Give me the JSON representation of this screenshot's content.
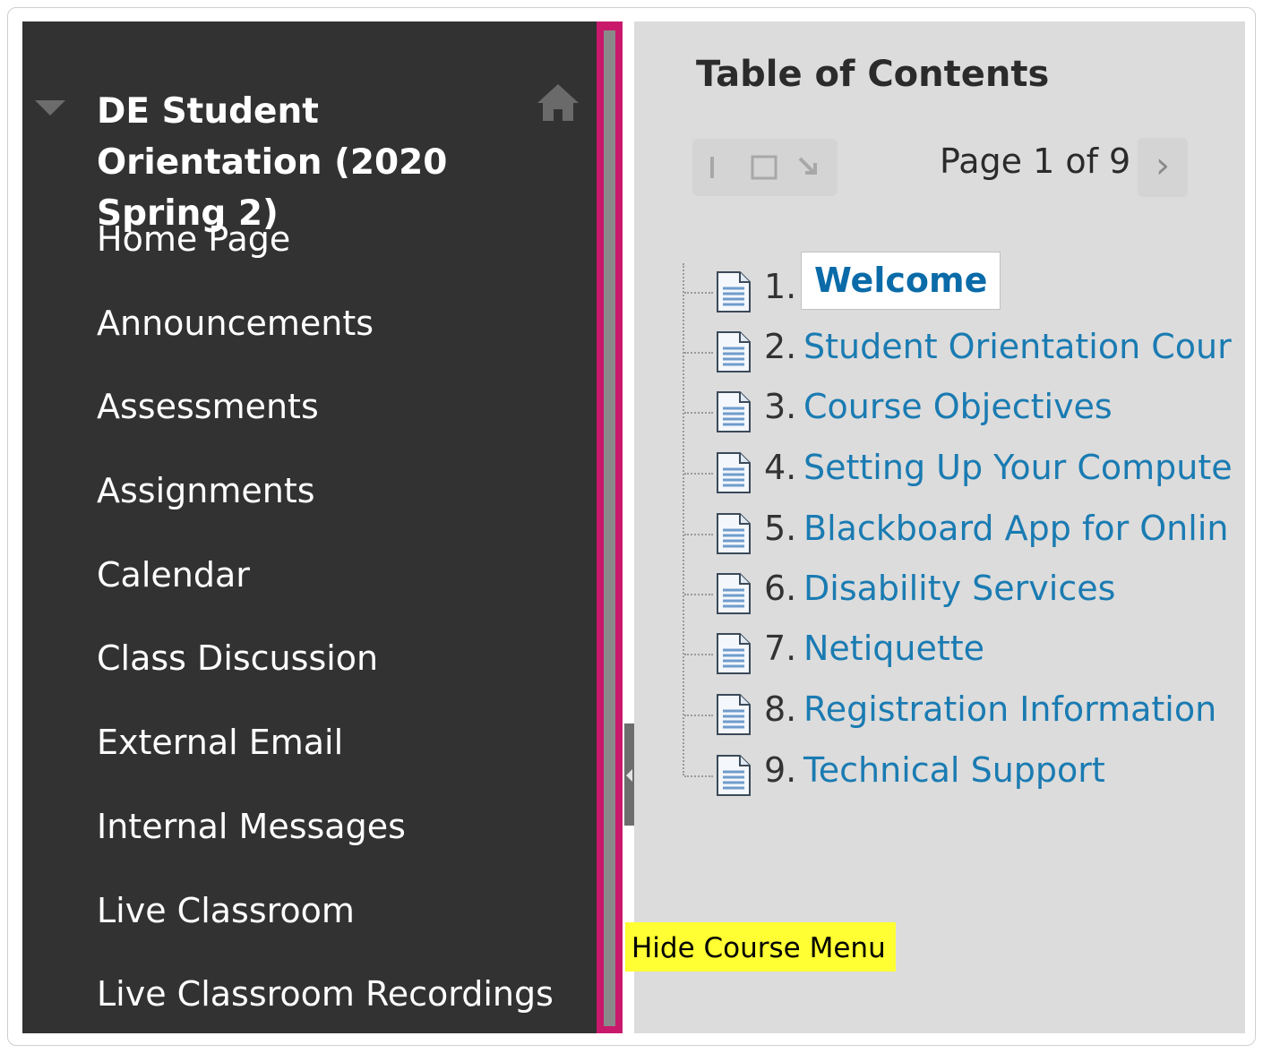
{
  "course_menu": {
    "course_title": "DE Student Orientation (2020 Spring 2)",
    "items": [
      {
        "label": "Home Page"
      },
      {
        "label": "Announcements"
      },
      {
        "label": "Assessments"
      },
      {
        "label": "Assignments"
      },
      {
        "label": "Calendar"
      },
      {
        "label": "Class Discussion"
      },
      {
        "label": "External Email"
      },
      {
        "label": "Internal Messages"
      },
      {
        "label": "Live Classroom"
      },
      {
        "label": "Live Classroom Recordings"
      }
    ]
  },
  "content": {
    "title": "Table of Contents",
    "pager": "Page 1 of 9",
    "next_glyph": "›",
    "toc": [
      {
        "num": "1.",
        "label": "Welcome",
        "selected": true
      },
      {
        "num": "2.",
        "label": "Student Orientation Cour"
      },
      {
        "num": "3.",
        "label": "Course Objectives"
      },
      {
        "num": "4.",
        "label": "Setting Up Your Compute"
      },
      {
        "num": "5.",
        "label": "Blackboard App for Onlin"
      },
      {
        "num": "6.",
        "label": "Disability Services"
      },
      {
        "num": "7.",
        "label": "Netiquette"
      },
      {
        "num": "8.",
        "label": "Registration Information"
      },
      {
        "num": "9.",
        "label": "Technical Support"
      }
    ]
  },
  "tooltip": "Hide Course Menu",
  "colors": {
    "menu_bg": "#323232",
    "divider_accent": "#c8196b",
    "content_bg": "#dcdcdc",
    "link": "#1a7bb2",
    "tooltip_bg": "#ffff33"
  }
}
